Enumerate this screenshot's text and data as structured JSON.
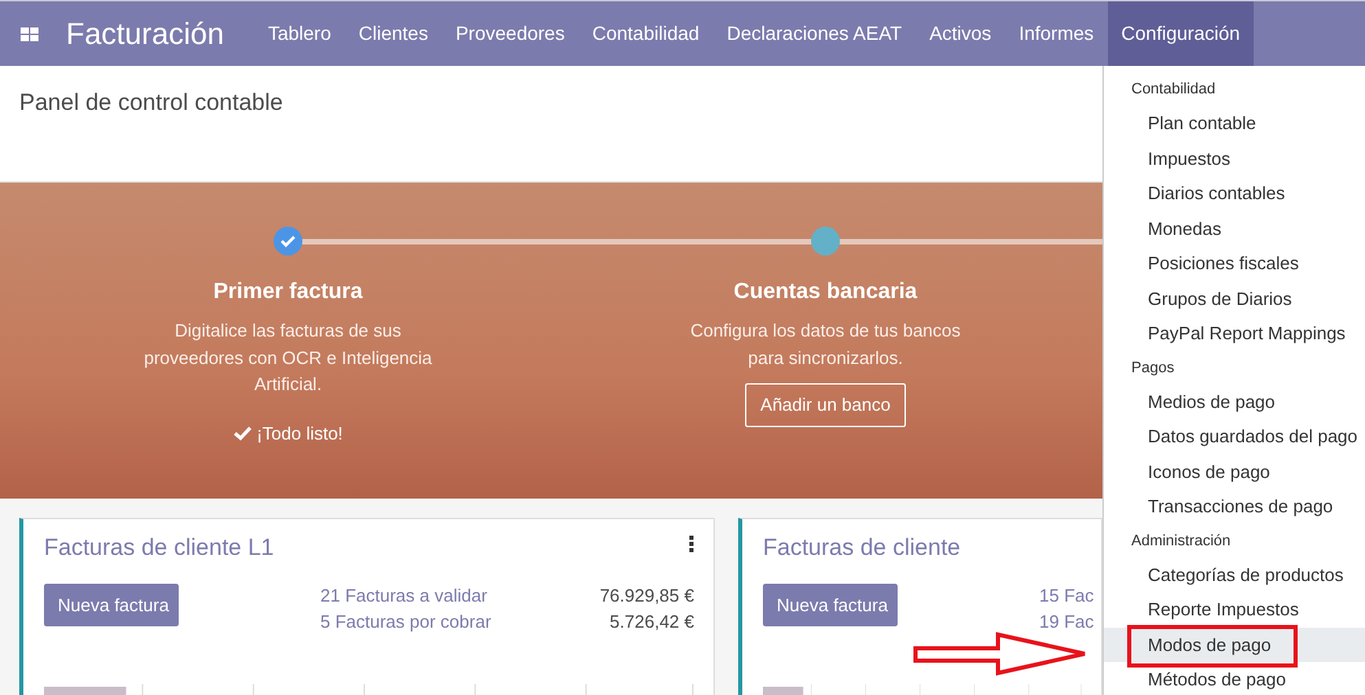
{
  "navbar": {
    "app_title": "Facturación",
    "menu": [
      {
        "label": "Tablero",
        "selected": false
      },
      {
        "label": "Clientes",
        "selected": false
      },
      {
        "label": "Proveedores",
        "selected": false
      },
      {
        "label": "Contabilidad",
        "selected": false
      },
      {
        "label": "Declaraciones AEAT",
        "selected": false
      },
      {
        "label": "Activos",
        "selected": false
      },
      {
        "label": "Informes",
        "selected": false
      },
      {
        "label": "Configuración",
        "selected": true
      }
    ]
  },
  "control_panel": {
    "title": "Panel de control contable"
  },
  "onboarding": {
    "steps": [
      {
        "title": "Primer factura",
        "description": "Digitalice las facturas de sus proveedores con OCR e Inteligencia Artificial.",
        "done": true,
        "status": "¡Todo listo!"
      },
      {
        "title": "Cuentas bancaria",
        "description": "Configura los datos de tus bancos para sincronizarlos.",
        "done": false,
        "button": "Añadir un banco"
      }
    ]
  },
  "cards": [
    {
      "title": "Facturas de cliente L1",
      "has_menu": true,
      "button": "Nueva factura",
      "lines": [
        {
          "label": "21 Facturas a validar",
          "amount": "76.929,85 €"
        },
        {
          "label": "5 Facturas por cobrar",
          "amount": "5.726,42 €"
        }
      ]
    },
    {
      "title": "Facturas de cliente",
      "has_menu": false,
      "button": "Nueva factura",
      "lines": [
        {
          "label": "15 Fac"
        },
        {
          "label": "19 Fac"
        }
      ]
    }
  ],
  "dropdown": {
    "items": [
      {
        "kind": "header",
        "label": "Contabilidad"
      },
      {
        "kind": "item",
        "label": "Plan contable",
        "selected": false,
        "annotated": false
      },
      {
        "kind": "item",
        "label": "Impuestos",
        "selected": false,
        "annotated": false
      },
      {
        "kind": "item",
        "label": "Diarios contables",
        "selected": false,
        "annotated": false
      },
      {
        "kind": "item",
        "label": "Monedas",
        "selected": false,
        "annotated": false
      },
      {
        "kind": "item",
        "label": "Posiciones fiscales",
        "selected": false,
        "annotated": false
      },
      {
        "kind": "item",
        "label": "Grupos de Diarios",
        "selected": false,
        "annotated": false
      },
      {
        "kind": "item",
        "label": "PayPal Report Mappings",
        "selected": false,
        "annotated": false
      },
      {
        "kind": "header",
        "label": "Pagos"
      },
      {
        "kind": "item",
        "label": "Medios de pago",
        "selected": false,
        "annotated": false
      },
      {
        "kind": "item",
        "label": "Datos guardados del pago",
        "selected": false,
        "annotated": false
      },
      {
        "kind": "item",
        "label": "Iconos de pago",
        "selected": false,
        "annotated": false
      },
      {
        "kind": "item",
        "label": "Transacciones de pago",
        "selected": false,
        "annotated": false
      },
      {
        "kind": "header",
        "label": "Administración"
      },
      {
        "kind": "item",
        "label": "Categorías de productos",
        "selected": false,
        "annotated": false
      },
      {
        "kind": "item",
        "label": "Reporte Impuestos",
        "selected": false,
        "annotated": false
      },
      {
        "kind": "item",
        "label": "Modos de pago",
        "selected": true,
        "annotated": true
      },
      {
        "kind": "item",
        "label": "Métodos de pago",
        "selected": false,
        "annotated": false
      }
    ]
  }
}
